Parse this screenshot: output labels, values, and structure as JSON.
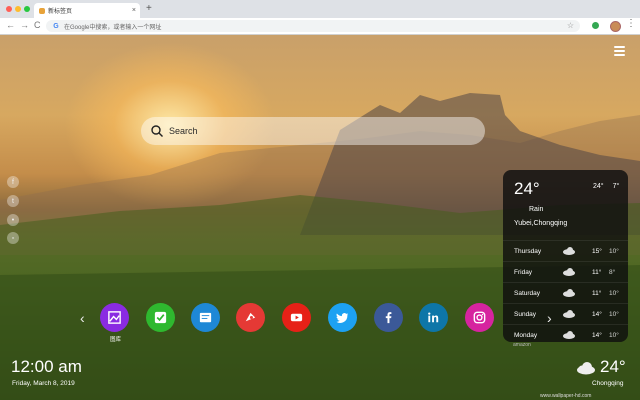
{
  "browser": {
    "tab_title": "新标签页",
    "tab_close": "×",
    "new_tab": "+",
    "omnibox_text": "在Google中搜索，或者输入一个网址",
    "back": "←",
    "forward": "→",
    "reload": "C",
    "bookmark_star": "☆",
    "menu": "⋮"
  },
  "search": {
    "placeholder": "Search"
  },
  "weather": {
    "current_temp": "24°",
    "high": "24°",
    "low": "7°",
    "condition": "Rain",
    "location": "Yubei,Chongqing",
    "forecast": [
      {
        "day": "Thursday",
        "high": "15°",
        "low": "10°"
      },
      {
        "day": "Friday",
        "high": "11°",
        "low": "8°"
      },
      {
        "day": "Saturday",
        "high": "11°",
        "low": "10°"
      },
      {
        "day": "Sunday",
        "high": "14°",
        "low": "10°"
      },
      {
        "day": "Monday",
        "high": "14°",
        "low": "10°"
      }
    ]
  },
  "dock": {
    "apps": [
      {
        "icon": "gallery-icon",
        "color": "#8a2be2"
      },
      {
        "icon": "checkbox-icon",
        "color": "#2fb82f"
      },
      {
        "icon": "notes-icon",
        "color": "#1e88d6"
      },
      {
        "icon": "game-icon",
        "color": "#e53935"
      },
      {
        "icon": "youtube-icon",
        "color": "#e62117"
      },
      {
        "icon": "twitter-icon",
        "color": "#1da1f2"
      },
      {
        "icon": "facebook-icon",
        "color": "#3b5998"
      },
      {
        "icon": "linkedin-icon",
        "color": "#0e76a8"
      },
      {
        "icon": "instagram-icon",
        "color": "#d6249f"
      }
    ],
    "first_app_label": "图库",
    "hidden_label": "amazon"
  },
  "clock": {
    "time": "12:00 am",
    "date": "Friday, March 8, 2019"
  },
  "bottom_weather": {
    "temp": "24°",
    "city": "Chongqing"
  },
  "watermark": "www.wallpaper-hd.com"
}
